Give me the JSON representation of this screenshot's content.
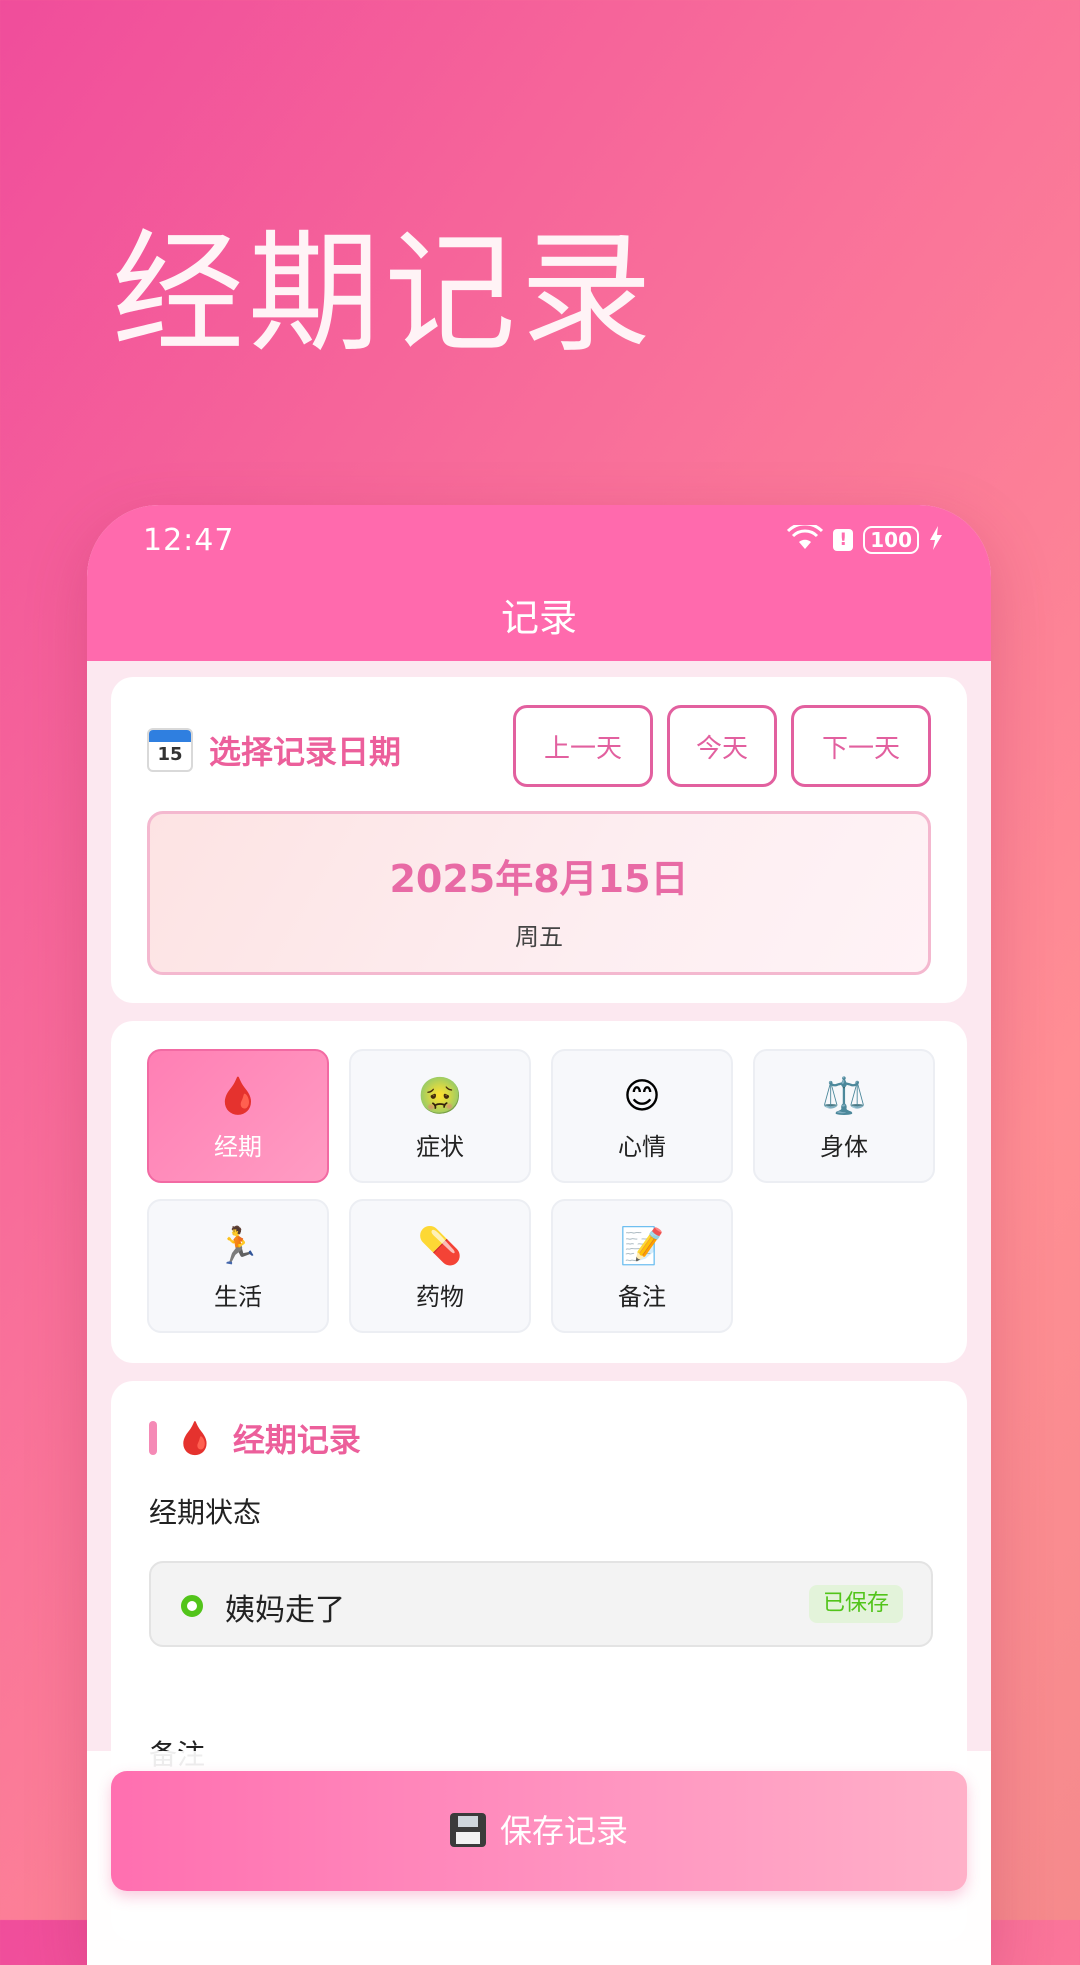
{
  "promo": {
    "title": "经期记录"
  },
  "statusbar": {
    "time": "12:47",
    "battery": "100"
  },
  "appbar": {
    "title": "记录"
  },
  "date_card": {
    "title": "选择记录日期",
    "prev_label": "上一天",
    "today_label": "今天",
    "next_label": "下一天",
    "date": "2025年8月15日",
    "weekday": "周五"
  },
  "categories": [
    {
      "label": "经期",
      "icon": "drop-of-blood-icon",
      "emoji": "🩸",
      "active": true
    },
    {
      "label": "症状",
      "icon": "nauseated-face-icon",
      "emoji": "🤢",
      "active": false
    },
    {
      "label": "心情",
      "icon": "smiling-face-icon",
      "emoji": "😊",
      "active": false
    },
    {
      "label": "身体",
      "icon": "balance-scale-icon",
      "emoji": "⚖️",
      "active": false
    },
    {
      "label": "生活",
      "icon": "running-person-icon",
      "emoji": "🏃",
      "active": false
    },
    {
      "label": "药物",
      "icon": "pill-icon",
      "emoji": "💊",
      "active": false
    },
    {
      "label": "备注",
      "icon": "memo-icon",
      "emoji": "📝",
      "active": false
    }
  ],
  "period_section": {
    "title": "经期记录",
    "status_label": "经期状态",
    "status_value": "姨妈走了",
    "saved_badge": "已保存",
    "notes_label": "备注"
  },
  "save_button": {
    "label": "保存记录"
  },
  "colors": {
    "brand": "#ff6aad",
    "accent": "#ec5f9b",
    "success": "#52c41a"
  }
}
